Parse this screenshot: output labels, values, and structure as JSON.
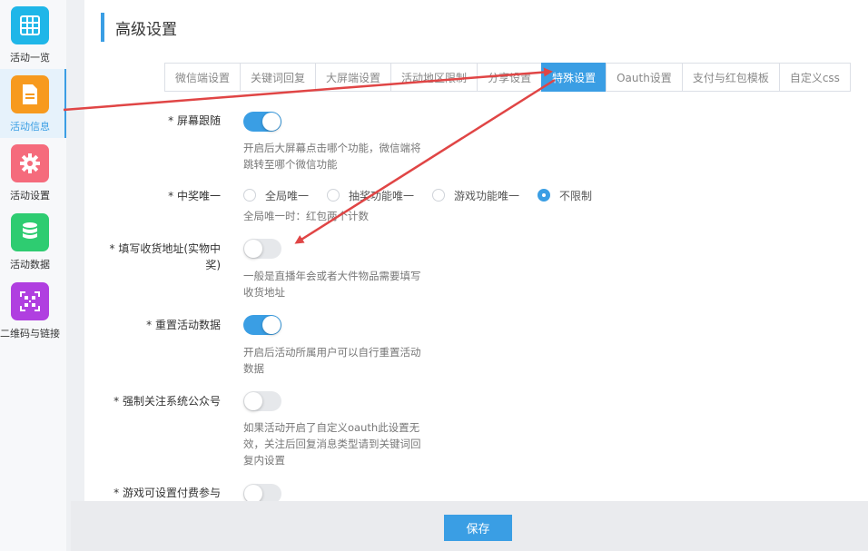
{
  "sidebar": {
    "items": [
      {
        "label": "活动一览",
        "icon": "grid-icon",
        "color": "#1fb6e8"
      },
      {
        "label": "活动信息",
        "icon": "document-icon",
        "color": "#f79a1e"
      },
      {
        "label": "活动设置",
        "icon": "gear-icon",
        "color": "#f56b7c"
      },
      {
        "label": "活动数据",
        "icon": "database-icon",
        "color": "#2ecc71"
      },
      {
        "label": "二维码与链接",
        "icon": "qrcode-icon",
        "color": "#b03fe0"
      }
    ],
    "active_index": 1
  },
  "page": {
    "title": "高级设置"
  },
  "tabs": [
    {
      "label": "微信端设置"
    },
    {
      "label": "关键词回复"
    },
    {
      "label": "大屏端设置"
    },
    {
      "label": "活动地区限制"
    },
    {
      "label": "分享设置"
    },
    {
      "label": "特殊设置"
    },
    {
      "label": "Oauth设置"
    },
    {
      "label": "支付与红包模板"
    },
    {
      "label": "自定义css"
    }
  ],
  "active_tab_index": 5,
  "settings": {
    "screen_follow": {
      "label": "* 屏幕跟随",
      "enabled": true,
      "desc_line1": "开启后大屏幕点击哪个功能，微信端将",
      "desc_line2": "跳转至哪个微信功能"
    },
    "prize_unique": {
      "label": "* 中奖唯一",
      "options": [
        "全局唯一",
        "抽奖功能唯一",
        "游戏功能唯一",
        "不限制"
      ],
      "selected": "不限制",
      "desc": "全局唯一时：红包两个计数"
    },
    "shipping_address": {
      "label_line1": "* 填写收货地址(实物中",
      "label_line2": "奖)",
      "enabled": false,
      "desc_line1": "一般是直播年会或者大件物品需要填写",
      "desc_line2": "收货地址"
    },
    "reset_data": {
      "label": "* 重置活动数据",
      "enabled": true,
      "desc_line1": "开启后活动所属用户可以自行重置活动",
      "desc_line2": "数据"
    },
    "force_follow": {
      "label": "* 强制关注系统公众号",
      "enabled": false,
      "desc_line1": "如果活动开启了自定义oauth此设置无",
      "desc_line2": "效，关注后回复消息类型请到关键词回",
      "desc_line3": "复内设置"
    },
    "paid_games": {
      "label": "* 游戏可设置付费参与",
      "enabled": false
    }
  },
  "footer": {
    "save_label": "保存"
  },
  "colors": {
    "accent": "#3a9ee4",
    "annotation_arrow": "#e04545"
  }
}
